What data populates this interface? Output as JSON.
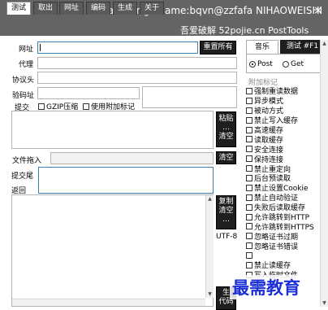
{
  "window": {
    "title": "author/gkfname:bqvn@zzfafa NIHAOWEISHI",
    "close_glyph": "×"
  },
  "tabs": [
    "测试",
    "取出",
    "网址",
    "编码",
    "生成",
    "关于"
  ],
  "header_links": "吾爱破解 52pojie.cn  PostTools",
  "form": {
    "url_label": "网址",
    "url_value": "",
    "reset_button": "重置所有",
    "proxy_label": "代理",
    "proxy_value": "",
    "protocol_header_label": "协议头",
    "protocol_header_value": "",
    "captcha_label": "验码址",
    "captcha_value": "",
    "submit_label": "提交",
    "gzip_label": "GZIP压缩",
    "gzip_checked": false,
    "extra_mark_label": "使用附加标记",
    "extra_mark_checked": false,
    "paste_button": "粘贴\n…\n清空",
    "file_drop_label": "文件拖入",
    "file_clear_button": "清空",
    "submit_tail_label": "提交尾",
    "return_label": "返回",
    "copy_clear_button": "复制\n清空\n…",
    "encoding": "UTF-8",
    "gen_code_button": "生\n代码"
  },
  "right_panel": {
    "tab_music": "音乐",
    "tab_test": "测试 #F1",
    "method_post": "Post",
    "method_get": "Get",
    "method_selected": "Post",
    "extra_group_label": "附加标记",
    "options": [
      "强制重读数据",
      "异步模式",
      "被动方式",
      "禁止写入缓存",
      "高速缓存",
      "读取缓存",
      "安全连接",
      "保持连接",
      "禁止重定向",
      "后台预读取",
      "禁止设置Cookie",
      "禁止自动验证",
      "失败后读取缓存",
      "允许跳转到HTTP",
      "允许跳转到HTTPS",
      "忽略证书过期",
      "忽略证书错误",
      "",
      "禁止读缓存",
      "写入临时文件"
    ]
  },
  "watermark": "最需教育",
  "colors": {
    "titlebar": "#646464",
    "dark_button": "#1e1e1e",
    "focus_border": "#3c7fb1",
    "watermark": "#1b2fd6"
  }
}
